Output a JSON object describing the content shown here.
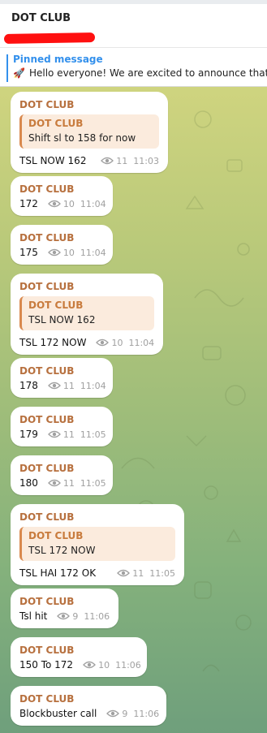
{
  "header": {
    "title": "DOT CLUB"
  },
  "pinned": {
    "label": "Pinned message",
    "icon": "rocket-icon",
    "text": "Hello everyone!  We are excited to announce that"
  },
  "messages": [
    {
      "sender": "DOT CLUB",
      "reply": {
        "name": "DOT CLUB",
        "text": "Shift sl to 158 for now"
      },
      "text": "TSL   NOW  162",
      "views": "11",
      "time": "11:03"
    },
    {
      "sender": "DOT CLUB",
      "text": "172",
      "views": "10",
      "time": "11:04"
    },
    {
      "sender": "DOT CLUB",
      "text": "175",
      "views": "10",
      "time": "11:04"
    },
    {
      "sender": "DOT CLUB",
      "reply": {
        "name": "DOT CLUB",
        "text": "TSL   NOW  162"
      },
      "text": "TSL  172 NOW",
      "views": "10",
      "time": "11:04"
    },
    {
      "sender": "DOT CLUB",
      "text": "178",
      "views": "11",
      "time": "11:04"
    },
    {
      "sender": "DOT CLUB",
      "text": "179",
      "views": "11",
      "time": "11:05"
    },
    {
      "sender": "DOT CLUB",
      "text": "180",
      "views": "11",
      "time": "11:05"
    },
    {
      "sender": "DOT CLUB",
      "reply": {
        "name": "DOT CLUB",
        "text": "TSL  172 NOW"
      },
      "text": "TSL  HAI  172   OK",
      "views": "11",
      "time": "11:05"
    },
    {
      "sender": "DOT CLUB",
      "text": "Tsl hit",
      "views": "9",
      "time": "11:06"
    },
    {
      "sender": "DOT CLUB",
      "text": "150 To 172",
      "views": "10",
      "time": "11:06"
    },
    {
      "sender": "DOT CLUB",
      "text": "Blockbuster call",
      "views": "9",
      "time": "11:06"
    }
  ],
  "colors": {
    "accent": "#3390ec",
    "sender": "#b7703e",
    "reply_bg": "#fbebdd",
    "redaction": "#ff1010"
  }
}
